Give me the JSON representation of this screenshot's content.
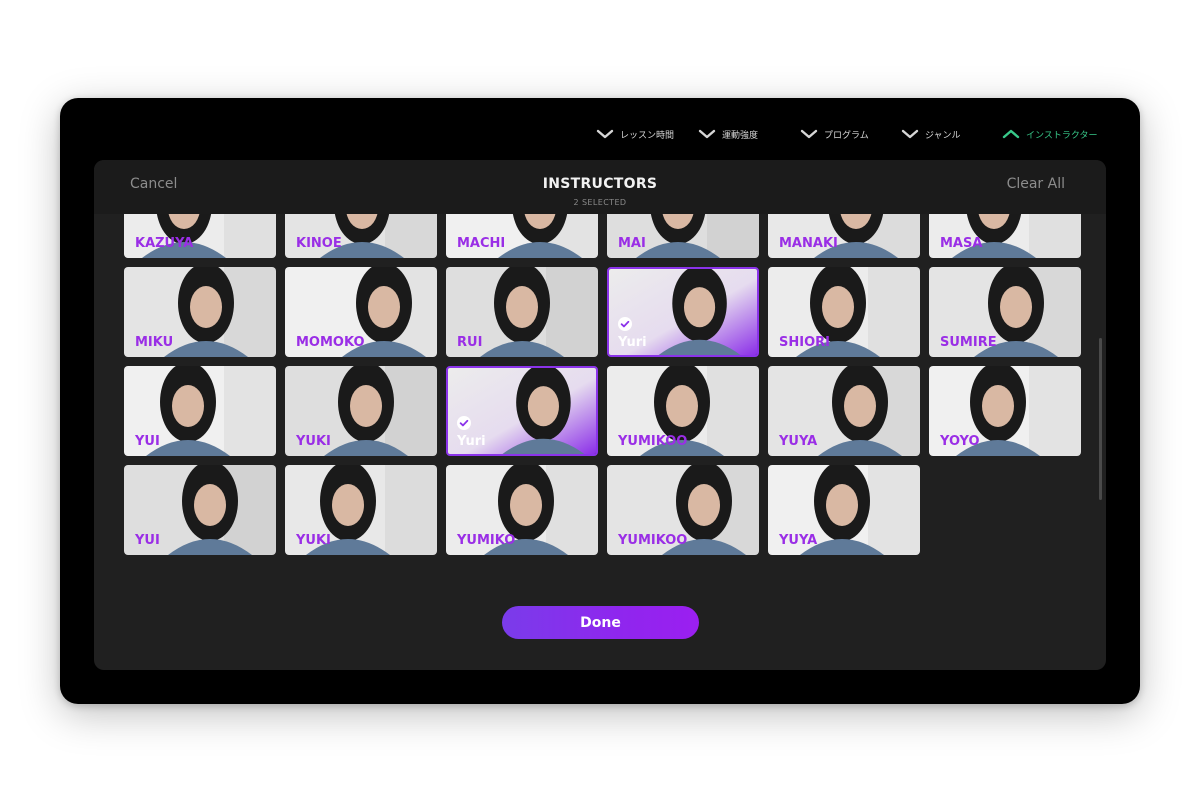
{
  "filters": [
    {
      "label": "レッスン時間",
      "icon": "chevron-down-icon",
      "active": false
    },
    {
      "label": "運動強度",
      "icon": "chevron-down-icon",
      "active": false
    },
    {
      "label": "プログラム",
      "icon": "chevron-down-icon",
      "active": false
    },
    {
      "label": "ジャンル",
      "icon": "chevron-down-icon",
      "active": false
    },
    {
      "label": "インストラクター",
      "icon": "chevron-up-icon",
      "active": true
    }
  ],
  "modal": {
    "cancel_label": "Cancel",
    "title": "INSTRUCTORS",
    "subtitle": "2 SELECTED",
    "clear_label": "Clear All",
    "done_label": "Done"
  },
  "colors": {
    "accent_purple": "#8b33ea",
    "active_filter": "#38c98a",
    "modal_bg": "#202020",
    "device_bg": "#000000"
  },
  "instructors": [
    {
      "name": "KAZUYA",
      "selected": false
    },
    {
      "name": "KINOE",
      "selected": false
    },
    {
      "name": "MACHI",
      "selected": false
    },
    {
      "name": "MAI",
      "selected": false
    },
    {
      "name": "MANAKI",
      "selected": false
    },
    {
      "name": "MASA",
      "selected": false
    },
    {
      "name": "MIKU",
      "selected": false
    },
    {
      "name": "MOMOKO",
      "selected": false
    },
    {
      "name": "RUI",
      "selected": false
    },
    {
      "name": "Yuri",
      "selected": true
    },
    {
      "name": "SHIORI",
      "selected": false
    },
    {
      "name": "SUMIRE",
      "selected": false
    },
    {
      "name": "YUI",
      "selected": false
    },
    {
      "name": "YUKI",
      "selected": false
    },
    {
      "name": "Yuri",
      "selected": true
    },
    {
      "name": "YUMIKOO",
      "selected": false
    },
    {
      "name": "YUYA",
      "selected": false
    },
    {
      "name": "YOYO",
      "selected": false
    },
    {
      "name": "YUI",
      "selected": false
    },
    {
      "name": "YUKI",
      "selected": false
    },
    {
      "name": "YUMIKO",
      "selected": false
    },
    {
      "name": "YUMIKOO",
      "selected": false
    },
    {
      "name": "YUYA",
      "selected": false
    }
  ]
}
